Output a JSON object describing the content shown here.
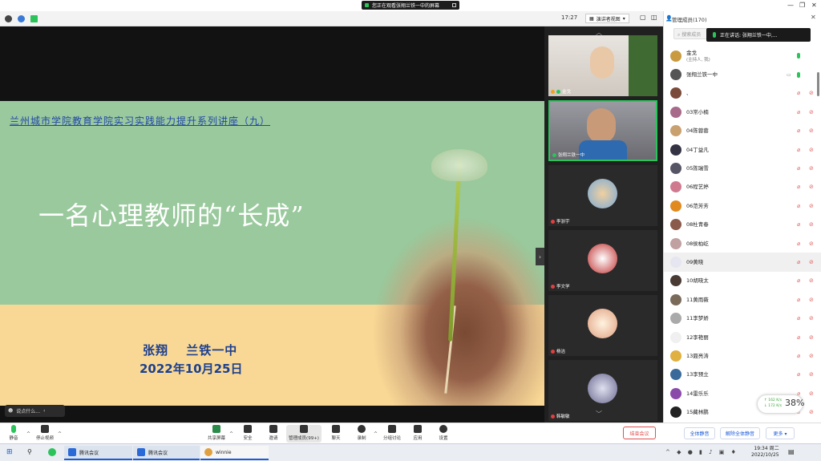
{
  "window": {
    "banner": "您正在观看张翔兰铁一中的屏幕"
  },
  "infobar": {
    "timer": "17:27",
    "view_mode": "演讲者视图"
  },
  "slide": {
    "series": "兰州城市学院教育学院实习实践能力提升系列讲座（九）",
    "title": "一名心理教师的“长成”",
    "author": "张翔　 兰铁一中",
    "date": "2022年10月25日"
  },
  "chat_hint": "说点什么...",
  "videos": [
    {
      "name": "金戈"
    },
    {
      "name": "张翔兰铁一中"
    },
    {
      "name": "李浙宇"
    },
    {
      "name": "李文学"
    },
    {
      "name": "杨洁"
    },
    {
      "name": "韩敏敏"
    }
  ],
  "panel": {
    "title": "管理成员(170)",
    "search_placeholder": "搜索成员",
    "speaking": "正在讲话: 张翔兰铁一中,..."
  },
  "members": [
    {
      "name": "金戈",
      "role": "(主持人, 我)",
      "color": "#c99a40",
      "mic": "on"
    },
    {
      "name": "张翔兰铁一中",
      "role": "",
      "color": "#555",
      "mic": "on"
    },
    {
      "name": "、",
      "role": "",
      "color": "#7a4a3a",
      "mic": "off"
    },
    {
      "name": "03常小楠",
      "role": "",
      "color": "#a86a8a",
      "mic": "off"
    },
    {
      "name": "04陈蓉蓉",
      "role": "",
      "color": "#c9a070",
      "mic": "off"
    },
    {
      "name": "04丁益凡",
      "role": "",
      "color": "#334",
      "mic": "off"
    },
    {
      "name": "05陈瑞雪",
      "role": "",
      "color": "#556",
      "mic": "off"
    },
    {
      "name": "06程艺婷",
      "role": "",
      "color": "#d07a90",
      "mic": "off"
    },
    {
      "name": "06范芳芳",
      "role": "",
      "color": "#e08a20",
      "mic": "off"
    },
    {
      "name": "08杜青春",
      "role": "",
      "color": "#8a5a4a",
      "mic": "off"
    },
    {
      "name": "08侯柏屹",
      "role": "",
      "color": "#c0a0a0",
      "mic": "off"
    },
    {
      "name": "09黄晓",
      "role": "",
      "color": "#e6e6f0",
      "mic": "off"
    },
    {
      "name": "10胡晓太",
      "role": "",
      "color": "#4a3a34",
      "mic": "off"
    },
    {
      "name": "11黄雨薇",
      "role": "",
      "color": "#7a6a5a",
      "mic": "off"
    },
    {
      "name": "11李梦娇",
      "role": "",
      "color": "#aaa",
      "mic": "off"
    },
    {
      "name": "12李艳丽",
      "role": "",
      "color": "#f0f0f0",
      "mic": "off"
    },
    {
      "name": "13聂亮涛",
      "role": "",
      "color": "#e0b040",
      "mic": "off"
    },
    {
      "name": "13李预立",
      "role": "",
      "color": "#3a6a9a",
      "mic": "off"
    },
    {
      "name": "14雷乐乐",
      "role": "",
      "color": "#8a4aaa",
      "mic": "off"
    },
    {
      "name": "15藏林鹏",
      "role": "",
      "color": "#222",
      "mic": "off"
    }
  ],
  "network": {
    "up": "↑ 162 K/s",
    "down": "↓ 172 K/s",
    "percent": "38%"
  },
  "toolbar": {
    "mute": "静音",
    "video": "停止视频",
    "share": "共享屏幕",
    "security": "安全",
    "invite": "邀请",
    "members": "管理成员(99+)",
    "chat": "聊天",
    "record": "录制",
    "breakout": "分组讨论",
    "apps": "应用",
    "settings": "设置",
    "end": "结束会议",
    "mute_all": "全体静音",
    "unmute_all": "解除全体静音",
    "more": "更多 ▾"
  },
  "taskbar": {
    "task1": "腾讯会议",
    "task2": "腾讯会议",
    "task3": "winnie",
    "time": "19:34 周二",
    "date": "2022/10/25"
  },
  "colors": {
    "accent": "#1e5cd6",
    "danger": "#e05050",
    "mic_on": "#2bc35a"
  }
}
